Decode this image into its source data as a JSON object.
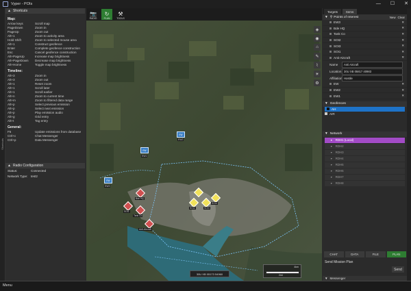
{
  "window": {
    "title": "Vyper - POIs",
    "min": "—",
    "max": "☐",
    "close": "✕"
  },
  "left_strip_label": "Shortcuts",
  "shortcuts": {
    "title": "Shortcuts",
    "groups": [
      {
        "name": "Map:",
        "items": [
          [
            "Arrow keys",
            "Scroll map"
          ],
          [
            "PageDown",
            "Zoom in"
          ],
          [
            "PageUp",
            "Zoom out"
          ],
          [
            "Alt+1",
            "Zoom to activity area"
          ],
          [
            "Hold Shift",
            "Zoom to selected mouse area"
          ],
          [
            "Alt+1",
            "Construct geofence"
          ],
          [
            "Enter",
            "Complete geofence construction"
          ],
          [
            "Esc",
            "Cancel geofence construction"
          ],
          [
            "Alt+PageUp",
            "Increase map brightness"
          ],
          [
            "Alt+PageDown",
            "Decrease map brightness"
          ],
          [
            "Alt+Home",
            "Toggle map brightness"
          ]
        ]
      },
      {
        "name": "Timeline:",
        "items": [
          [
            "Alt+3",
            "Zoom in"
          ],
          [
            "Alt+3",
            "Zoom out"
          ],
          [
            "Alt+1",
            "Reset zoom"
          ],
          [
            "Alt+1",
            "Scroll later"
          ],
          [
            "Alt+1",
            "Scroll earlier"
          ],
          [
            "Alt+n",
            "Zoom to current time"
          ],
          [
            "Alt+m",
            "Zoom to filtered data range"
          ],
          [
            "Alt+p",
            "Select previous emission"
          ],
          [
            "Alt+p",
            "Select next emission"
          ],
          [
            "Alt+p",
            "Play emission audio"
          ],
          [
            "Alt+g",
            "Grid entry"
          ],
          [
            "Alt+t",
            "Tag entry"
          ]
        ]
      },
      {
        "name": "General:",
        "items": [
          [
            "F5",
            "Update emissions from database"
          ],
          [
            "Ctrl+c",
            "Chat Messenger"
          ],
          [
            "Ctrl+p",
            "Data Messenger"
          ]
        ]
      }
    ]
  },
  "radio": {
    "title": "Radio Configuration",
    "rows": [
      [
        "Status:",
        "Connected"
      ],
      [
        "Network Type:",
        "test2"
      ]
    ]
  },
  "toolbar": {
    "buttons": [
      {
        "label": "RADIO",
        "icon": "📷"
      },
      {
        "label": "PLAN",
        "icon": "↻"
      },
      {
        "label": "TOOLS",
        "icon": "⚒"
      }
    ]
  },
  "map": {
    "coord": "30U XB 05173 54960",
    "scale_top": "4km",
    "scale_bottom": "2mi",
    "markers": [
      {
        "label": "EW2",
        "type": "box",
        "text": "EW"
      },
      {
        "label": "EW1",
        "type": "box",
        "text": "EW"
      },
      {
        "label": "EW3",
        "type": "box",
        "text": "EW"
      },
      {
        "label": "Bde HQ",
        "type": "red"
      },
      {
        "label": "SOI1",
        "type": "red"
      },
      {
        "label": "Tank Co",
        "type": "red"
      },
      {
        "label": "Anti-Aircraft",
        "type": "red"
      },
      {
        "label": "SOI2",
        "type": "yel"
      },
      {
        "label": "SOI3",
        "type": "yel"
      },
      {
        "label": "SOI4",
        "type": "yel"
      }
    ]
  },
  "right": {
    "tabs": [
      "Targets",
      "Items"
    ],
    "poi": {
      "title": "Points of Interest",
      "new": "New",
      "clear": "Clear",
      "items": [
        "EW3",
        "Bde HQ",
        "Tank Co",
        "SOI2",
        "SOI3",
        "SOI1",
        "Anti-Aircraft"
      ]
    },
    "form": {
      "name_label": "Name",
      "name_value": "Anti Aircraft",
      "location_label": "Location",
      "location_value": "30U XB 05817 40983",
      "affil_label": "Affiliation",
      "affil_value": "Hostile"
    },
    "ew_items": [
      "EW",
      "EW2",
      "EW1"
    ],
    "geofences": {
      "title": "Geofences",
      "items": [
        "AH",
        "AIR"
      ]
    },
    "network": {
      "title": "Network",
      "items": [
        "RDH1 (Local)",
        "RDH2",
        "RDH3",
        "RDH4",
        "RDH5",
        "RDH6",
        "RDH7",
        "RDH8"
      ]
    },
    "bottom_tabs": [
      "CHAT",
      "DATA",
      "FILE",
      "PLAN"
    ],
    "send_title": "Send Mission Plan",
    "send": "Send",
    "messenger": "Messenger"
  },
  "taskbar": {
    "menu": "Menu"
  }
}
